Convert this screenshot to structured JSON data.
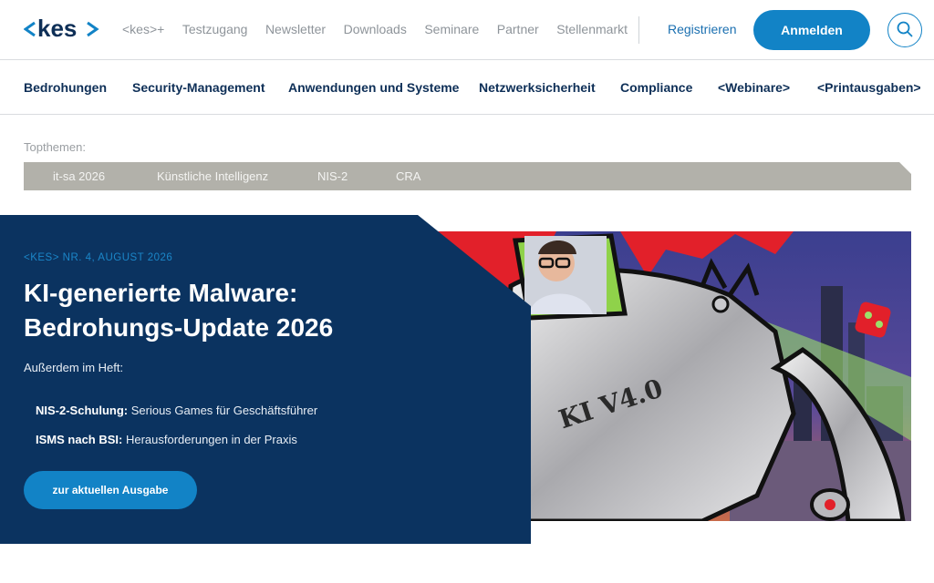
{
  "header": {
    "logo_text": "<kes>",
    "top_links": [
      "<kes>+",
      "Testzugang",
      "Newsletter",
      "Downloads",
      "Seminare",
      "Partner",
      "Stellenmarkt"
    ],
    "register_label": "Registrieren",
    "login_label": "Anmelden"
  },
  "main_nav": [
    "Bedrohungen",
    "Security-Management",
    "Anwendungen und Systeme",
    "Netzwerksicherheit",
    "Compliance",
    "<Webinare>",
    "<Printausgaben>"
  ],
  "topthemen": {
    "label": "Topthemen:",
    "items": [
      "it-sa 2026",
      "Künstliche Intelligenz",
      "NIS-2",
      "CRA"
    ]
  },
  "hero": {
    "issue": "<KES> NR. 4, AUGUST 2026",
    "title_line1": "KI-generierte Malware:",
    "title_line2": "Bedrohungs-Update 2026",
    "also_label": "Außerdem im Heft:",
    "bullets": [
      {
        "bold": "NIS-2-Schulung:",
        "text": " Serious Games für Geschäftsführer"
      },
      {
        "bold": "ISMS nach BSI:",
        "text": " Herausforderungen in der Praxis"
      }
    ],
    "cta_label": "zur aktuellen Ausgabe",
    "image_text": "KI V4.0"
  },
  "colors": {
    "navy": "#0b3360",
    "brand_blue": "#1283c6",
    "topthemen_bar": "#b2b1aa"
  }
}
